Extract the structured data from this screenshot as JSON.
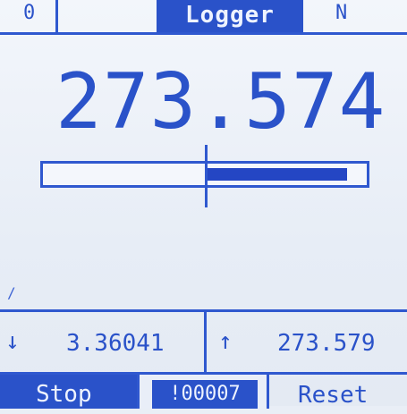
{
  "topbar": {
    "left": "0",
    "title": "Logger",
    "right": "N"
  },
  "reading": {
    "value": "273.574",
    "bar_fill_fraction": 0.44
  },
  "corner_mark": "/",
  "stats": {
    "min_arrow": "↓",
    "min": "3.36041",
    "max_arrow": "↑",
    "max": "273.579"
  },
  "softkeys": {
    "stop": "Stop",
    "counter": "!00007",
    "reset": "Reset"
  },
  "colors": {
    "accent": "#2a52c9",
    "background": "#eef2f8"
  }
}
